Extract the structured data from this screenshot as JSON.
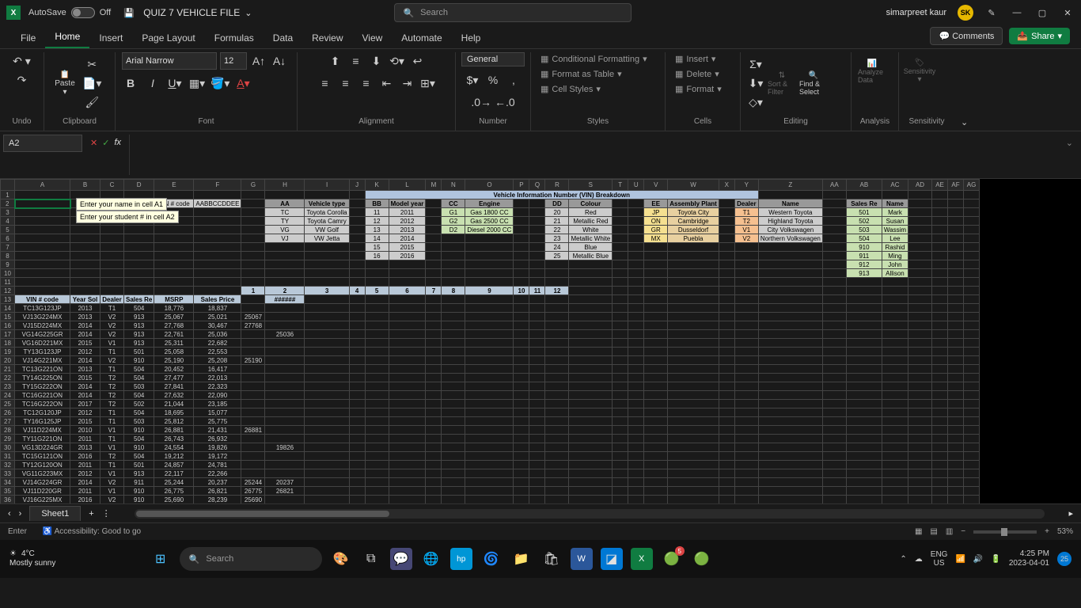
{
  "titlebar": {
    "autosave_label": "AutoSave",
    "autosave_state": "Off",
    "doc_title": "QUIZ 7 VEHICLE FILE",
    "search_placeholder": "Search",
    "user_name": "simarpreet kaur",
    "user_initials": "SK"
  },
  "tabs": {
    "items": [
      "File",
      "Home",
      "Insert",
      "Page Layout",
      "Formulas",
      "Data",
      "Review",
      "View",
      "Automate",
      "Help"
    ],
    "active": "Home",
    "comments": "Comments",
    "share": "Share"
  },
  "ribbon": {
    "undo": "Undo",
    "clipboard": "Clipboard",
    "paste": "Paste",
    "font_group": "Font",
    "font_name": "Arial Narrow",
    "font_size": "12",
    "alignment": "Alignment",
    "number_group": "Number",
    "number_format": "General",
    "styles": "Styles",
    "cond_fmt": "Conditional Formatting",
    "fmt_table": "Format as Table",
    "cell_styles": "Cell Styles",
    "cells": "Cells",
    "insert": "Insert",
    "delete": "Delete",
    "format": "Format",
    "editing": "Editing",
    "sort_filter": "Sort & Filter",
    "find_select": "Find & Select",
    "analysis": "Analysis",
    "analyze_data": "Analyze Data",
    "sensitivity": "Sensitivity",
    "sensitivity_btn": "Sensitivity"
  },
  "namebox": "A2",
  "tooltips": {
    "a1": "Enter your name in cell A1",
    "a2": "Enter your student # in cell A2"
  },
  "sheet": {
    "title_row": "Vehicle Information Number (VIN) Breakdown",
    "vin_code_hdr": "VIN # code",
    "vin_code_pattern": "AABBCCDDEE",
    "lookup_aa": {
      "hdrs": [
        "AA",
        "Vehicle type"
      ],
      "rows": [
        [
          "TC",
          "Toyota Corolla"
        ],
        [
          "TY",
          "Toyota Camry"
        ],
        [
          "VG",
          "VW Golf"
        ],
        [
          "VJ",
          "VW Jetta"
        ]
      ]
    },
    "lookup_bb": {
      "hdrs": [
        "BB",
        "Model year"
      ],
      "rows": [
        [
          "11",
          "2011"
        ],
        [
          "12",
          "2012"
        ],
        [
          "13",
          "2013"
        ],
        [
          "14",
          "2014"
        ],
        [
          "15",
          "2015"
        ],
        [
          "16",
          "2016"
        ]
      ]
    },
    "lookup_cc": {
      "hdrs": [
        "CC",
        "Engine"
      ],
      "rows": [
        [
          "G1",
          "Gas 1800 CC"
        ],
        [
          "G2",
          "Gas 2500 CC"
        ],
        [
          "D2",
          "Diesel 2000 CC"
        ]
      ]
    },
    "lookup_dd": {
      "hdrs": [
        "DD",
        "Colour"
      ],
      "rows": [
        [
          "20",
          "Red"
        ],
        [
          "21",
          "Metallic Red"
        ],
        [
          "22",
          "White"
        ],
        [
          "23",
          "Metallic White"
        ],
        [
          "24",
          "Blue"
        ],
        [
          "25",
          "Metallic Blue"
        ]
      ]
    },
    "lookup_ee": {
      "hdrs": [
        "EE",
        "Assembly Plant"
      ],
      "rows": [
        [
          "JP",
          "Toyota City"
        ],
        [
          "ON",
          "Cambridge"
        ],
        [
          "GR",
          "Dusseldorf"
        ],
        [
          "MX",
          "Puebla"
        ]
      ]
    },
    "lookup_dealer": {
      "hdrs": [
        "Dealer",
        "Name"
      ],
      "rows": [
        [
          "T1",
          "Western Toyota"
        ],
        [
          "T2",
          "Highland Toyota"
        ],
        [
          "V1",
          "City Volkswagen"
        ],
        [
          "V2",
          "Northern Volkswagen"
        ]
      ]
    },
    "lookup_sales": {
      "hdrs": [
        "Sales Re",
        "Name"
      ],
      "rows": [
        [
          "501",
          "Mark"
        ],
        [
          "502",
          "Susan"
        ],
        [
          "503",
          "Wassim"
        ],
        [
          "504",
          "Lee"
        ],
        [
          "910",
          "Rashid"
        ],
        [
          "911",
          "Ming"
        ],
        [
          "912",
          "John"
        ],
        [
          "913",
          "Allison"
        ]
      ]
    },
    "data_hdrs": [
      "VIN # code",
      "Year Sol",
      "Dealer",
      "Sales Re",
      "MSRP",
      "Sales Price"
    ],
    "num_hdrs": [
      "1",
      "2",
      "3",
      "4",
      "5",
      "6",
      "7",
      "8",
      "9",
      "10",
      "11",
      "12"
    ],
    "num_row2_c2": "######",
    "data": [
      [
        "TC13G123JP",
        "2013",
        "T1",
        "504",
        "18,776",
        "18,837",
        "",
        ""
      ],
      [
        "VJ13G224MX",
        "2013",
        "V2",
        "913",
        "25,067",
        "25,021",
        "25067",
        ""
      ],
      [
        "VJ15D224MX",
        "2014",
        "V2",
        "913",
        "27,768",
        "30,467",
        "27768",
        ""
      ],
      [
        "VG14G225GR",
        "2014",
        "V2",
        "913",
        "22,761",
        "25,036",
        "",
        "25036"
      ],
      [
        "VG16D221MX",
        "2015",
        "V1",
        "913",
        "25,311",
        "22,682",
        "",
        ""
      ],
      [
        "TY13G123JP",
        "2012",
        "T1",
        "501",
        "25,058",
        "22,553",
        "",
        ""
      ],
      [
        "VJ14G221MX",
        "2014",
        "V2",
        "910",
        "25,190",
        "25,208",
        "25190",
        ""
      ],
      [
        "TC13G221ON",
        "2013",
        "T1",
        "504",
        "20,452",
        "16,417",
        "",
        ""
      ],
      [
        "TY14G225ON",
        "2015",
        "T2",
        "504",
        "27,477",
        "22,013",
        "",
        ""
      ],
      [
        "TY15G222ON",
        "2014",
        "T2",
        "503",
        "27,841",
        "22,323",
        "",
        ""
      ],
      [
        "TC16G221ON",
        "2014",
        "T2",
        "504",
        "27,632",
        "22,090",
        "",
        ""
      ],
      [
        "TC16G222ON",
        "2017",
        "T2",
        "502",
        "21,044",
        "23,185",
        "",
        ""
      ],
      [
        "TC12G120JP",
        "2012",
        "T1",
        "504",
        "18,695",
        "15,077",
        "",
        ""
      ],
      [
        "TY16G125JP",
        "2015",
        "T1",
        "503",
        "25,812",
        "25,775",
        "",
        ""
      ],
      [
        "VJ11D224MX",
        "2010",
        "V1",
        "910",
        "26,881",
        "21,431",
        "26881",
        ""
      ],
      [
        "TY11G221ON",
        "2011",
        "T1",
        "504",
        "26,743",
        "26,932",
        "",
        ""
      ],
      [
        "VG13D224GR",
        "2013",
        "V1",
        "910",
        "24,554",
        "19,826",
        "",
        "19826"
      ],
      [
        "TC15G121ON",
        "2016",
        "T2",
        "504",
        "19,212",
        "19,172",
        "",
        ""
      ],
      [
        "TY12G120ON",
        "2011",
        "T1",
        "501",
        "24,857",
        "24,781",
        "",
        ""
      ],
      [
        "VG11G223MX",
        "2012",
        "V1",
        "913",
        "22,117",
        "22,266",
        "",
        ""
      ],
      [
        "VJ14G224GR",
        "2014",
        "V2",
        "911",
        "25,244",
        "20,237",
        "25244",
        "20237"
      ],
      [
        "VJ11D220GR",
        "2011",
        "V1",
        "910",
        "26,775",
        "26,821",
        "26775",
        "26821"
      ],
      [
        "VJ16G225MX",
        "2016",
        "V2",
        "910",
        "25,690",
        "28,239",
        "25690",
        ""
      ]
    ]
  },
  "sheettab": "Sheet1",
  "statusbar": {
    "mode": "Enter",
    "access": "Accessibility: Good to go",
    "zoom": "53%"
  },
  "taskbar": {
    "temp": "4°C",
    "weather": "Mostly sunny",
    "search": "Search",
    "lang1": "ENG",
    "lang2": "US",
    "time": "4:25 PM",
    "date": "2023-04-01",
    "notif": "25"
  },
  "chart_data": {
    "type": "table",
    "note": "No chart present; spreadsheet lookup and transaction tables."
  }
}
